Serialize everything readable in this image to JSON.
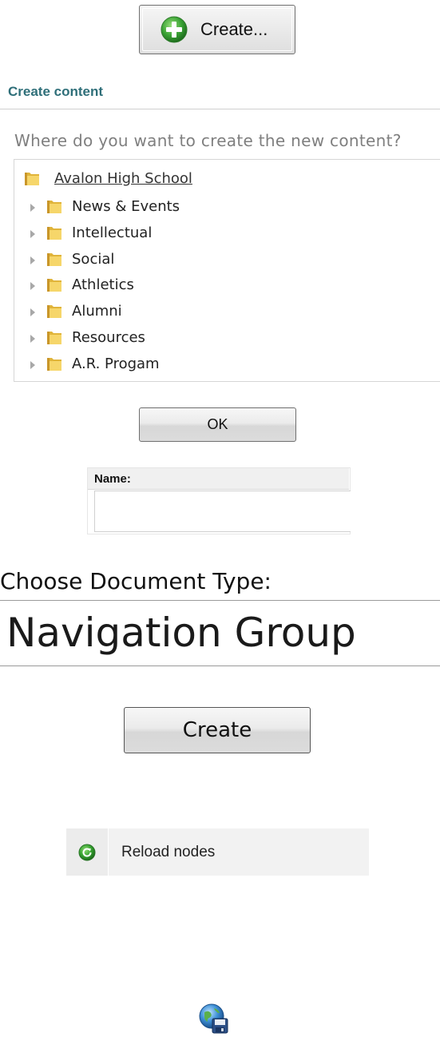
{
  "create_menu": {
    "label": "Create..."
  },
  "create_content": {
    "title": "Create content",
    "question": "Where do you want to create the new content?"
  },
  "tree": {
    "root": "Avalon High School",
    "items": [
      "News & Events",
      "Intellectual",
      "Social",
      "Athletics",
      "Alumni",
      "Resources",
      "A.R. Progam"
    ]
  },
  "ok_button": {
    "label": "OK"
  },
  "name_field": {
    "label": "Name:",
    "value": ""
  },
  "document_type": {
    "label": "Choose Document Type:",
    "selected": "Navigation Group"
  },
  "create_button": {
    "label": "Create"
  },
  "reload": {
    "label": "Reload nodes"
  },
  "icons": {
    "create": "add-green-icon",
    "folder": "folder-icon",
    "reload": "reload-green-icon",
    "publish": "globe-save-icon"
  },
  "colors": {
    "title": "#2f6f79",
    "question": "#7f7f7f",
    "green": "#3aa335"
  }
}
